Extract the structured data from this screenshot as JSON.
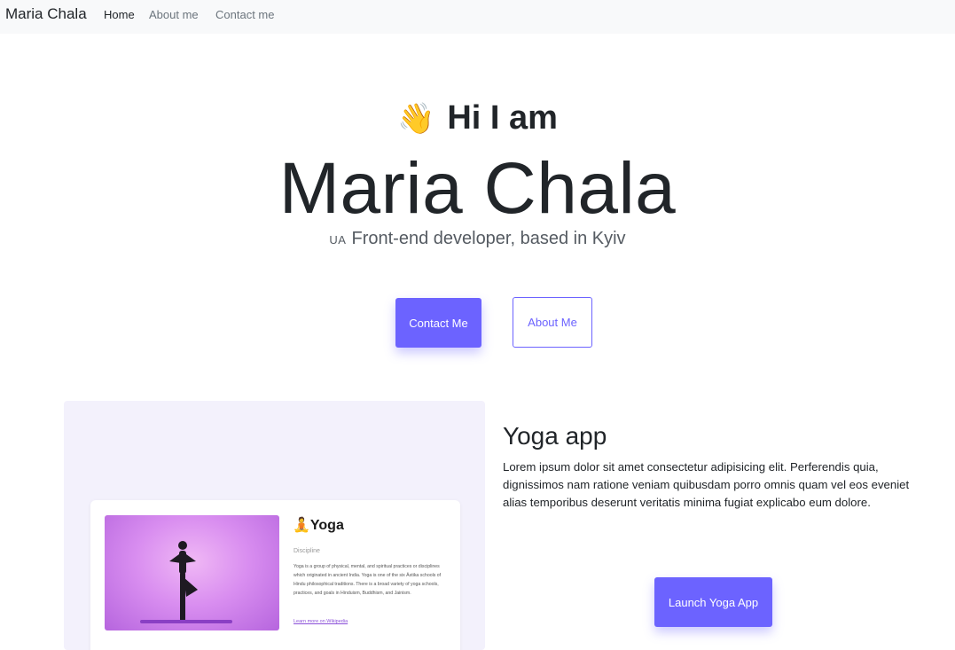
{
  "navbar": {
    "brand": "Maria Chala",
    "links": [
      "Home",
      "About me",
      "Contact me"
    ]
  },
  "hero": {
    "wave_icon": "👋",
    "greeting": "Hi I am",
    "name": "Maria Chala",
    "flag_code": "UA",
    "subtitle": "Front-end developer, based in Kyiv",
    "contact_button": "Contact Me",
    "about_button": "About Me"
  },
  "project": {
    "title": "Yoga app",
    "description": "Lorem ipsum dolor sit amet consectetur adipisicing elit. Perferendis quia, dignissimos nam ratione veniam quibusdam porro omnis quam vel eos eveniet alias temporibus deserunt veritatis minima fugiat explicabo eum dolore.",
    "launch_button": "Launch Yoga App",
    "preview": {
      "title": "🧘Yoga",
      "meta": "Discipline",
      "description": "Yoga is a group of physical, mental, and spiritual practices or disciplines which originated in ancient India. Yoga is one of the six Āstika schools of Hindu philosophical traditions. There is a broad variety of yoga schools, practices, and goals in Hinduism, Buddhism, and Jainism.",
      "link": "Learn more on Wikipedia"
    }
  },
  "colors": {
    "accent": "#6c63ff",
    "navbar_bg": "#f8f9fa",
    "preview_bg": "#f3f1fc"
  }
}
